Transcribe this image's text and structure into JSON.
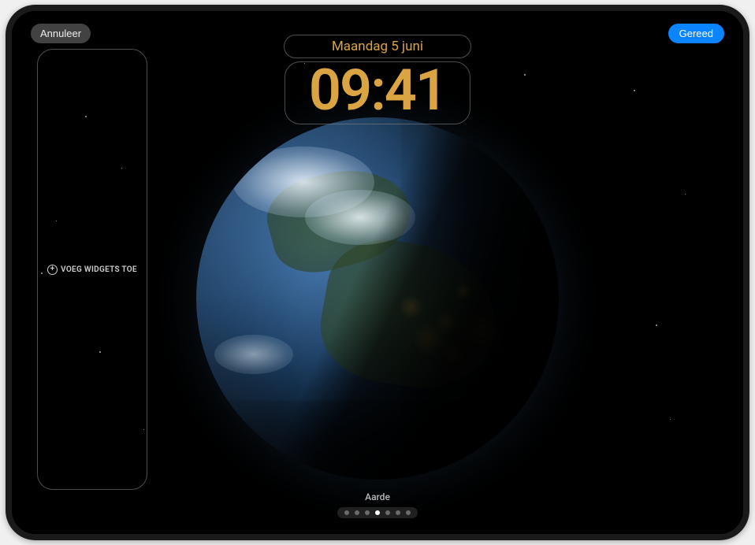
{
  "header": {
    "cancel_label": "Annuleer",
    "done_label": "Gereed"
  },
  "clock": {
    "date": "Maandag 5 juni",
    "time": "09:41"
  },
  "widget_panel": {
    "add_label": "VOEG WIDGETS TOE"
  },
  "wallpaper": {
    "name": "Aarde"
  },
  "pager": {
    "total": 7,
    "active_index": 3
  },
  "colors": {
    "clock_color": "#d9a441",
    "done_bg": "#0a84ff"
  }
}
